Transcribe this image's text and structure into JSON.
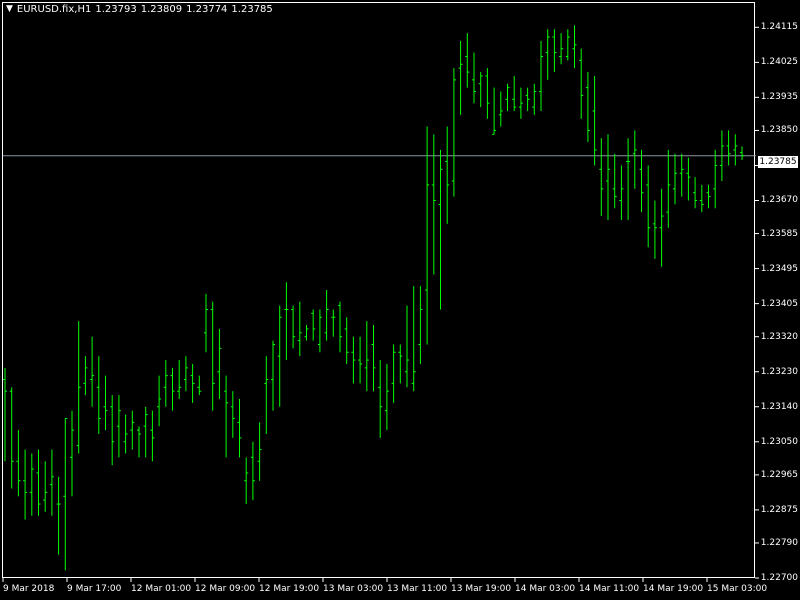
{
  "window": {
    "symbol_menu_icon": "triangle-down-icon",
    "symbol": "EURUSD.fix,H1",
    "ohlc": [
      "1.23793",
      "1.23809",
      "1.23774",
      "1.23785"
    ]
  },
  "axis": {
    "price_ticks": [
      "1.24115",
      "1.24025",
      "1.23935",
      "1.23850",
      "1.23760",
      "1.23670",
      "1.23585",
      "1.23495",
      "1.23405",
      "1.23320",
      "1.23230",
      "1.23140",
      "1.23050",
      "1.22965",
      "1.22875",
      "1.22790",
      "1.22700"
    ],
    "time_ticks": [
      "9 Mar 2018",
      "9 Mar 17:00",
      "12 Mar 01:00",
      "12 Mar 09:00",
      "12 Mar 19:00",
      "13 Mar 03:00",
      "13 Mar 11:00",
      "13 Mar 19:00",
      "14 Mar 03:00",
      "14 Mar 11:00",
      "14 Mar 19:00",
      "15 Mar 03:00"
    ],
    "current_price": "1.23785"
  },
  "colors": {
    "background": "#000000",
    "bars": "#00ff00",
    "frame": "#ffffff",
    "text": "#ffffff",
    "current_price_line": "#8a95a3"
  },
  "chart_data": {
    "type": "ohlc",
    "timeframe": "H1",
    "ylim": [
      1.227,
      1.2418
    ],
    "bars": [
      [
        1.2321,
        1.2324,
        1.23,
        1.2318
      ],
      [
        1.2318,
        1.2319,
        1.2293,
        1.23
      ],
      [
        1.23,
        1.2308,
        1.2291,
        1.2295
      ],
      [
        1.2295,
        1.2303,
        1.2285,
        1.2292
      ],
      [
        1.2292,
        1.2302,
        1.2286,
        1.2298
      ],
      [
        1.2297,
        1.2303,
        1.2286,
        1.2289
      ],
      [
        1.229,
        1.23,
        1.2287,
        1.2292
      ],
      [
        1.2294,
        1.2303,
        1.2286,
        1.2296
      ],
      [
        1.2289,
        1.2296,
        1.2276,
        1.2289
      ],
      [
        1.2291,
        1.2311,
        1.2272,
        1.2311
      ],
      [
        1.2301,
        1.2313,
        1.2291,
        1.2308
      ],
      [
        1.2304,
        1.2336,
        1.2302,
        1.2319
      ],
      [
        1.232,
        1.2327,
        1.2317,
        1.2324
      ],
      [
        1.2321,
        1.2332,
        1.2314,
        1.2322
      ],
      [
        1.2319,
        1.2327,
        1.2307,
        1.2311
      ],
      [
        1.2314,
        1.2322,
        1.2308,
        1.2313
      ],
      [
        1.2314,
        1.2317,
        1.2299,
        1.2305
      ],
      [
        1.2309,
        1.2317,
        1.2301,
        1.2313
      ],
      [
        1.2305,
        1.2312,
        1.2302,
        1.2307
      ],
      [
        1.2308,
        1.2313,
        1.2303,
        1.231
      ],
      [
        1.2308,
        1.2309,
        1.2301,
        1.2307
      ],
      [
        1.2309,
        1.2314,
        1.2301,
        1.2312
      ],
      [
        1.2308,
        1.2313,
        1.23,
        1.2306
      ],
      [
        1.2314,
        1.2322,
        1.2309,
        1.2316
      ],
      [
        1.2319,
        1.2326,
        1.2314,
        1.2322
      ],
      [
        1.2322,
        1.2324,
        1.2313,
        1.2318
      ],
      [
        1.2318,
        1.2326,
        1.2316,
        1.2319
      ],
      [
        1.2321,
        1.2327,
        1.2318,
        1.2324
      ],
      [
        1.2322,
        1.2325,
        1.2315,
        1.232
      ],
      [
        1.2319,
        1.2322,
        1.2317,
        1.2318
      ],
      [
        1.2333,
        1.2343,
        1.2328,
        1.2339
      ],
      [
        1.2339,
        1.2341,
        1.2313,
        1.232
      ],
      [
        1.2323,
        1.2334,
        1.2316,
        1.2329
      ],
      [
        1.2318,
        1.2322,
        1.2301,
        1.2315
      ],
      [
        1.2314,
        1.2318,
        1.2306,
        1.2311
      ],
      [
        1.231,
        1.2316,
        1.2301,
        1.2306
      ],
      [
        1.2295,
        1.2301,
        1.2289,
        1.2297
      ],
      [
        1.2301,
        1.2305,
        1.229,
        1.2295
      ],
      [
        1.23,
        1.231,
        1.2295,
        1.2303
      ],
      [
        1.232,
        1.2327,
        1.2307,
        1.2321
      ],
      [
        1.2321,
        1.2331,
        1.2313,
        1.233
      ],
      [
        1.2327,
        1.234,
        1.2314,
        1.2337
      ],
      [
        1.2339,
        1.2346,
        1.2326,
        1.2339
      ],
      [
        1.2339,
        1.234,
        1.2329,
        1.2332
      ],
      [
        1.2331,
        1.2341,
        1.2327,
        1.2333
      ],
      [
        1.2332,
        1.2335,
        1.2331,
        1.2334
      ],
      [
        1.2338,
        1.2339,
        1.2331,
        1.2334
      ],
      [
        1.233,
        1.2339,
        1.2328,
        1.2337
      ],
      [
        1.2333,
        1.2344,
        1.2331,
        1.2339
      ],
      [
        1.2337,
        1.2339,
        1.2332,
        1.2337
      ],
      [
        1.234,
        1.2341,
        1.2328,
        1.2332
      ],
      [
        1.2334,
        1.2337,
        1.2325,
        1.2328
      ],
      [
        1.2328,
        1.2332,
        1.232,
        1.2326
      ],
      [
        1.2326,
        1.2332,
        1.232,
        1.2325
      ],
      [
        1.2324,
        1.2336,
        1.2318,
        1.2326
      ],
      [
        1.233,
        1.2335,
        1.2318,
        1.2324
      ],
      [
        1.2319,
        1.2326,
        1.2306,
        1.2314
      ],
      [
        1.2313,
        1.2325,
        1.2308,
        1.2318
      ],
      [
        1.232,
        1.233,
        1.2315,
        1.2328
      ],
      [
        1.2328,
        1.233,
        1.232,
        1.2327
      ],
      [
        1.2323,
        1.234,
        1.2319,
        1.2326
      ],
      [
        1.232,
        1.2345,
        1.2318,
        1.2323
      ],
      [
        1.233,
        1.2345,
        1.2325,
        1.2339
      ],
      [
        1.2344,
        1.2386,
        1.233,
        1.2371
      ],
      [
        1.2371,
        1.2384,
        1.2348,
        1.2367
      ],
      [
        1.2366,
        1.238,
        1.2339,
        1.2375
      ],
      [
        1.2377,
        1.2386,
        1.2361,
        1.2371
      ],
      [
        1.2372,
        1.2401,
        1.2368,
        1.2398
      ],
      [
        1.2401,
        1.2408,
        1.2389,
        1.2402
      ],
      [
        1.2404,
        1.241,
        1.2396,
        1.24
      ],
      [
        1.2398,
        1.2405,
        1.2392,
        1.2395
      ],
      [
        1.2397,
        1.24,
        1.2391,
        1.2399
      ],
      [
        1.2399,
        1.2401,
        1.2388,
        1.2392
      ],
      [
        1.2384,
        1.2396,
        1.2384,
        1.2385
      ],
      [
        1.2389,
        1.2395,
        1.2386,
        1.239
      ],
      [
        1.2393,
        1.2397,
        1.239,
        1.2396
      ],
      [
        1.2393,
        1.2399,
        1.239,
        1.2391
      ],
      [
        1.2391,
        1.2396,
        1.2388,
        1.2392
      ],
      [
        1.2394,
        1.2396,
        1.239,
        1.2393
      ],
      [
        1.2391,
        1.2397,
        1.2389,
        1.2395
      ],
      [
        1.2395,
        1.2408,
        1.239,
        1.2404
      ],
      [
        1.2405,
        1.2411,
        1.2398,
        1.2409
      ],
      [
        1.2409,
        1.2411,
        1.24,
        1.2405
      ],
      [
        1.2404,
        1.241,
        1.2402,
        1.2406
      ],
      [
        1.2404,
        1.2411,
        1.2403,
        1.2409
      ],
      [
        1.2406,
        1.2412,
        1.2401,
        1.2407
      ],
      [
        1.2403,
        1.2406,
        1.2388,
        1.2394
      ],
      [
        1.2396,
        1.24,
        1.2382,
        1.2385
      ],
      [
        1.239,
        1.2399,
        1.2376,
        1.238
      ],
      [
        1.2375,
        1.2383,
        1.2363,
        1.237
      ],
      [
        1.2372,
        1.2384,
        1.2362,
        1.2375
      ],
      [
        1.237,
        1.2379,
        1.2365,
        1.2368
      ],
      [
        1.2367,
        1.2376,
        1.2362,
        1.237
      ],
      [
        1.2377,
        1.2383,
        1.2362,
        1.2377
      ],
      [
        1.2379,
        1.2385,
        1.237,
        1.238
      ],
      [
        1.2375,
        1.238,
        1.2364,
        1.2369
      ],
      [
        1.2371,
        1.2376,
        1.2355,
        1.236
      ],
      [
        1.2361,
        1.2367,
        1.2352,
        1.236
      ],
      [
        1.236,
        1.237,
        1.235,
        1.2363
      ],
      [
        1.2364,
        1.238,
        1.236,
        1.2371
      ],
      [
        1.237,
        1.2379,
        1.2366,
        1.2374
      ],
      [
        1.2374,
        1.2379,
        1.2368,
        1.2375
      ],
      [
        1.2374,
        1.2378,
        1.2367,
        1.2373
      ],
      [
        1.2369,
        1.2373,
        1.2365,
        1.2367
      ],
      [
        1.2367,
        1.2371,
        1.2364,
        1.2366
      ],
      [
        1.2369,
        1.2371,
        1.2365,
        1.2368
      ],
      [
        1.237,
        1.238,
        1.2365,
        1.2376
      ],
      [
        1.2376,
        1.2385,
        1.2372,
        1.2381
      ],
      [
        1.2381,
        1.2385,
        1.2376,
        1.2379
      ],
      [
        1.238,
        1.2384,
        1.2376,
        1.2381
      ],
      [
        1.23793,
        1.23809,
        1.23774,
        1.23785
      ]
    ]
  }
}
